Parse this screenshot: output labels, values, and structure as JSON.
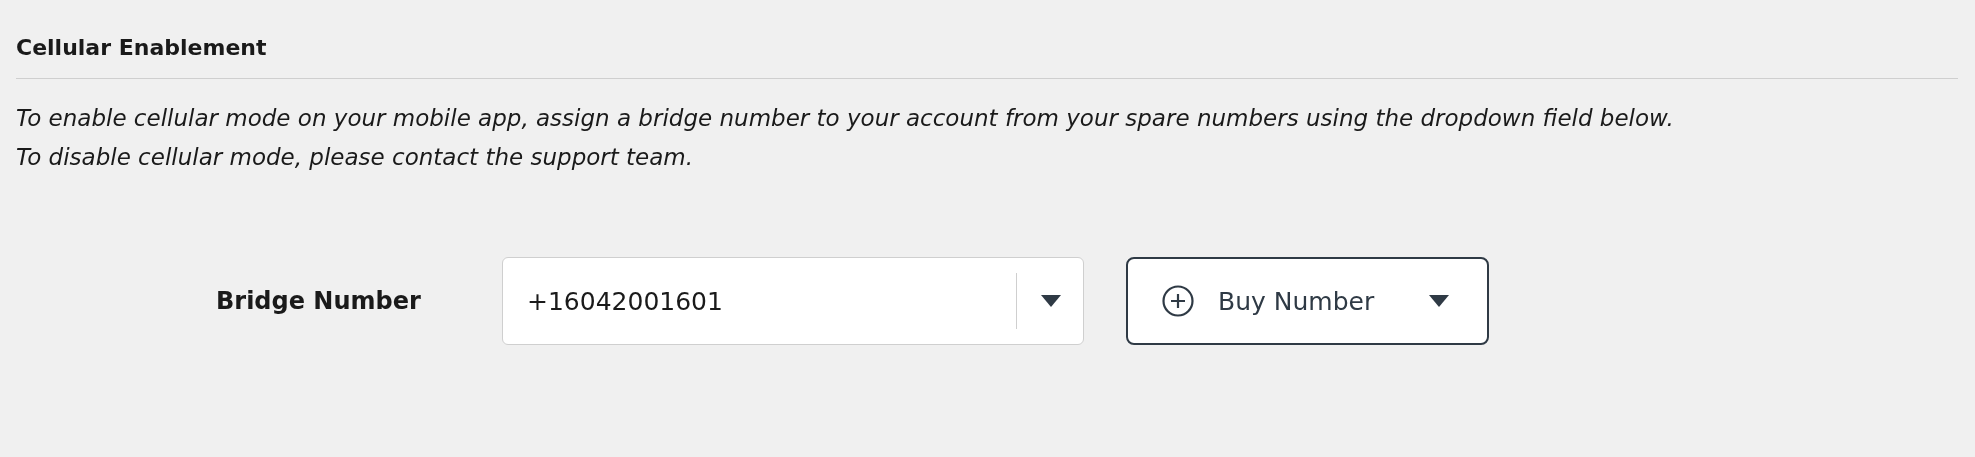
{
  "section": {
    "title": "Cellular Enablement"
  },
  "description": [
    "To enable cellular mode on your mobile app, assign a bridge number to your account from your spare numbers using the dropdown field below.",
    "To disable cellular mode, please contact the support team."
  ],
  "bridge_number": {
    "label": "Bridge Number",
    "value": "+16042001601"
  },
  "buy_button": {
    "label": "Buy Number"
  }
}
